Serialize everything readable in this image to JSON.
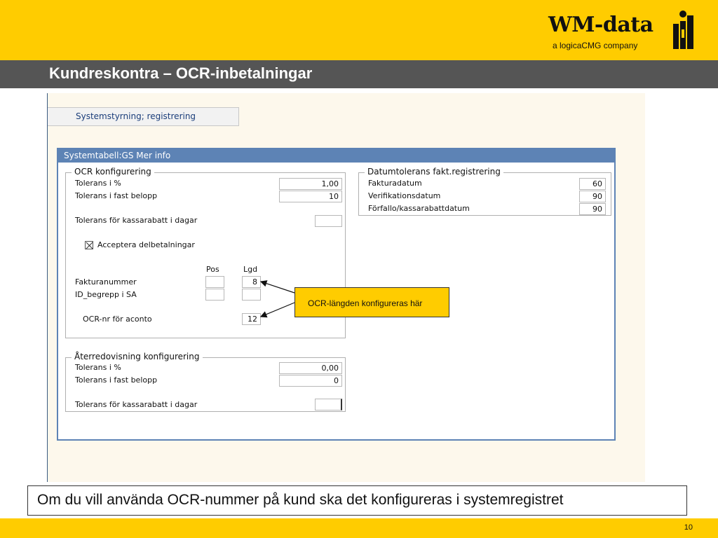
{
  "slide": {
    "title": "Kundreskontra – OCR-inbetalningar",
    "caption": "Om du vill använda OCR-nummer på kund ska det konfigureras i systemregistret",
    "page_number": "10"
  },
  "logo": {
    "name": "WM-data",
    "subtitle": "a logicaCMG company"
  },
  "colors": {
    "brand_yellow": "#ffcc00",
    "title_bar": "#555555",
    "panel_blue": "#5d83b5"
  },
  "app": {
    "tab_label": "Systemstyrning; registrering",
    "panel_title": "Systemtabell:GS  Mer info",
    "ocr": {
      "title": "OCR konfigurering",
      "tolerans_pct_label": "Tolerans i %",
      "tolerans_pct_value": "1,00",
      "tolerans_belopp_label": "Tolerans i fast belopp",
      "tolerans_belopp_value": "10",
      "kassarabatt_label": "Tolerans för kassarabatt i dagar",
      "kassarabatt_value": "",
      "delbetalningar_label": "Acceptera delbetalningar",
      "delbetalningar_checked": true,
      "pos_header": "Pos",
      "lgd_header": "Lgd",
      "fakturanummer_label": "Fakturanummer",
      "fakturanummer_pos": "",
      "fakturanummer_lgd": "8",
      "id_begrepp_label": "ID_begrepp i SA",
      "id_begrepp_pos": "",
      "id_begrepp_lgd": "",
      "aconto_label": "OCR-nr för aconto",
      "aconto_lgd": "12"
    },
    "datumtolerans": {
      "title": "Datumtolerans fakt.registrering",
      "fakturadatum_label": "Fakturadatum",
      "fakturadatum_value": "60",
      "verifikationsdatum_label": "Verifikationsdatum",
      "verifikationsdatum_value": "90",
      "forfallo_label": "Förfallo/kassarabattdatum",
      "forfallo_value": "90"
    },
    "aterredovisning": {
      "title": "Återredovisning konfigurering",
      "tolerans_pct_label": "Tolerans i %",
      "tolerans_pct_value": "0,00",
      "tolerans_belopp_label": "Tolerans i fast belopp",
      "tolerans_belopp_value": "0",
      "kassarabatt_label": "Tolerans för kassarabatt i dagar",
      "kassarabatt_value": ""
    }
  },
  "callout": {
    "text": "OCR-längden konfigureras här"
  }
}
